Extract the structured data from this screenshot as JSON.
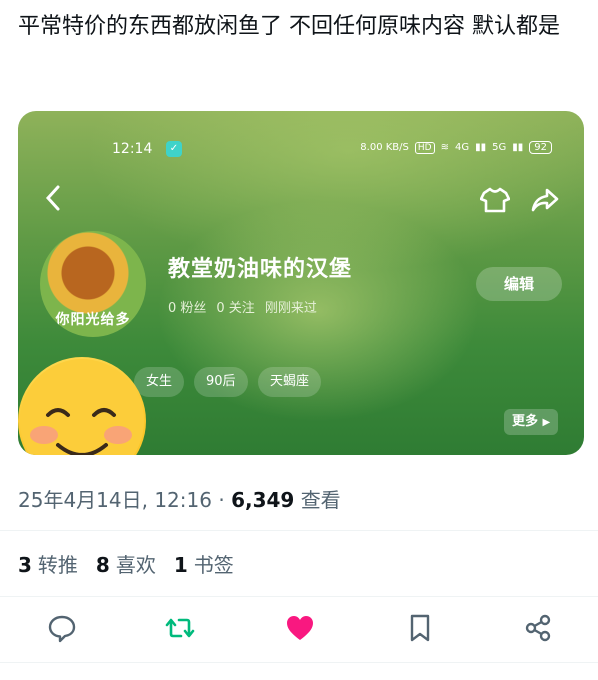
{
  "post": {
    "text": "平常特价的东西都放闲鱼了 不回任何原味内容 默认都是"
  },
  "embed": {
    "status_bar": {
      "time": "12:14",
      "speed": "8.00 KB/S",
      "hd": "HD",
      "network_4g": "4G",
      "network_5g": "5G",
      "battery": "92"
    },
    "profile": {
      "avatar_caption": "你阳光给多",
      "name": "教堂奶油味的汉堡",
      "fans": "0 粉丝",
      "following": "0 关注",
      "last_seen": "刚刚来过",
      "edit_label": "编辑",
      "tags": [
        "女生",
        "90后",
        "天蝎座"
      ],
      "more_label": "更多"
    }
  },
  "meta": {
    "date": "25年4月14日, 12:16",
    "separator": "·",
    "views_count": "6,349",
    "views_label": "查看"
  },
  "stats": {
    "retweets_count": "3",
    "retweets_label": "转推",
    "likes_count": "8",
    "likes_label": "喜欢",
    "bookmarks_count": "1",
    "bookmarks_label": "书签"
  },
  "colors": {
    "retweet": "#00ba7c",
    "like": "#f91880",
    "icon": "#536471"
  },
  "icons": [
    "reply-icon",
    "retweet-icon",
    "like-icon",
    "bookmark-icon",
    "share-icon"
  ]
}
